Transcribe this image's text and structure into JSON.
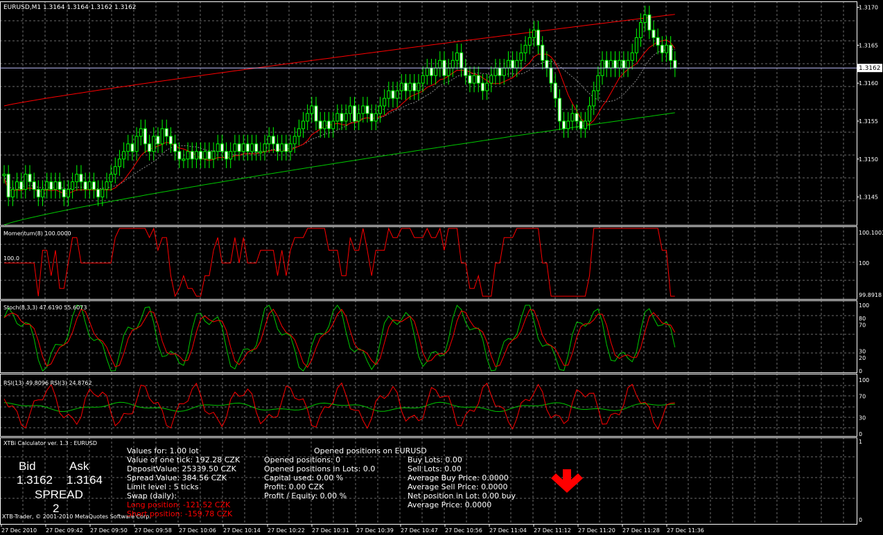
{
  "colors": {
    "bg": "#000000",
    "grid": "#6b6b6b",
    "axis": "#ffffff",
    "upper_band": "#ff0000",
    "lower_band": "#00c800",
    "ma_fast": "#ff0000",
    "candle_up": "#000000",
    "candle_down": "#ffffff",
    "candle_wick": "#00ff00",
    "rsi13": "#00c800",
    "rsi3": "#ff0000",
    "stoch_k": "#00c800",
    "stoch_d": "#ff0000",
    "momentum": "#ff0000",
    "price_line": "#c0c0ff"
  },
  "main": {
    "title": "EURUSD,M1  1.3164 1.3164 1.3162 1.3162",
    "y_ticks": [
      "1.3170",
      "1.3165",
      "1.3160",
      "1.3155",
      "1.3150",
      "1.3145"
    ],
    "current_price": "1.3162"
  },
  "momentum": {
    "title": "Momentum(8) 100.0000",
    "level_label": "100.0",
    "y_ticks": [
      "100.1003",
      "100",
      "99.8918"
    ]
  },
  "stoch": {
    "title": "Stoch(8,3,3) 47.6190 55.6073",
    "y_ticks": [
      "100",
      "80",
      "70",
      "30",
      "20",
      "0"
    ]
  },
  "rsi": {
    "title": "RSI(13) 49.8096  RSI(3) 24.8762",
    "y_ticks": [
      "100",
      "70",
      "30",
      "0"
    ]
  },
  "calc": {
    "title": "XTBi Calculator ver. 1.3 : EURUSD",
    "bid_label": "Bid",
    "ask_label": "Ask",
    "bid": "1.3162",
    "ask": "1.3164",
    "spread_label": "SPREAD",
    "spread": "2",
    "col1": [
      "Values for: 1.00 lot",
      "Value of one tick: 192.28 CZK",
      "DepositValue: 25339.50 CZK",
      "Spread Value: 384.56 CZK",
      "Limit level : 5 ticks",
      "Swap (daily):"
    ],
    "long": "Long position: -121.52 CZK",
    "short": "Short position: -159.78 CZK",
    "opened_title": "Opened positions on EURUSD",
    "col2": [
      "Opened positions: 0",
      "Opened positions in Lots: 0.0",
      "Capital used: 0.00 %",
      "Profit: 0.00 CZK",
      "Profit / Equity: 0.00 %"
    ],
    "col3": [
      "Buy Lots: 0.00",
      "Sell Lots: 0.00",
      "Average Buy Price: 0.0000",
      "Average Sell Price: 0.0000",
      "Net position in Lot: 0.00 buy",
      "Average Price: 0.0000"
    ],
    "copyright": "XTB-Trader, © 2001-2010 MetaQuotes Software Corp.",
    "y_ticks": [
      "1",
      "0"
    ]
  },
  "time_axis": [
    "27 Dec 2010",
    "27 Dec 09:42",
    "27 Dec 09:50",
    "27 Dec 09:58",
    "27 Dec 10:06",
    "27 Dec 10:14",
    "27 Dec 10:22",
    "27 Dec 10:31",
    "27 Dec 10:39",
    "27 Dec 10:47",
    "27 Dec 10:56",
    "27 Dec 11:04",
    "27 Dec 11:12",
    "27 Dec 11:20",
    "27 Dec 11:28",
    "27 Dec 11:36"
  ],
  "chart_data": {
    "type": "line",
    "closes": [
      1.3148,
      1.3145,
      1.3146,
      1.3147,
      1.3146,
      1.3148,
      1.3147,
      1.3146,
      1.3145,
      1.3146,
      1.3147,
      1.3146,
      1.3147,
      1.3146,
      1.3145,
      1.3146,
      1.3147,
      1.3148,
      1.3147,
      1.3146,
      1.3147,
      1.3146,
      1.3145,
      1.3146,
      1.3147,
      1.3148,
      1.3149,
      1.315,
      1.3151,
      1.3152,
      1.3151,
      1.3153,
      1.3154,
      1.3152,
      1.3151,
      1.3153,
      1.3152,
      1.3154,
      1.3153,
      1.3152,
      1.3151,
      1.315,
      1.315,
      1.3151,
      1.315,
      1.3151,
      1.315,
      1.3151,
      1.315,
      1.3151,
      1.3152,
      1.3151,
      1.315,
      1.3151,
      1.3152,
      1.3151,
      1.3152,
      1.3151,
      1.3152,
      1.3151,
      1.3151,
      1.3152,
      1.3153,
      1.3152,
      1.3151,
      1.3152,
      1.3151,
      1.3152,
      1.3153,
      1.3154,
      1.3155,
      1.3156,
      1.3157,
      1.3155,
      1.3154,
      1.3155,
      1.3154,
      1.3155,
      1.3156,
      1.3155,
      1.3156,
      1.3157,
      1.3155,
      1.3156,
      1.3157,
      1.3156,
      1.3155,
      1.3156,
      1.3157,
      1.3158,
      1.3159,
      1.3158,
      1.3159,
      1.316,
      1.3159,
      1.316,
      1.3159,
      1.316,
      1.3161,
      1.3162,
      1.3161,
      1.3162,
      1.3163,
      1.3161,
      1.3162,
      1.3163,
      1.3164,
      1.3162,
      1.3161,
      1.316,
      1.3161,
      1.316,
      1.3159,
      1.316,
      1.3161,
      1.3162,
      1.3161,
      1.3162,
      1.3163,
      1.3162,
      1.3163,
      1.3164,
      1.3165,
      1.3166,
      1.3167,
      1.3165,
      1.3163,
      1.3162,
      1.316,
      1.3158,
      1.3155,
      1.3154,
      1.3155,
      1.3156,
      1.3155,
      1.3154,
      1.3155,
      1.3157,
      1.3159,
      1.3161,
      1.3163,
      1.3162,
      1.3163,
      1.3162,
      1.3163,
      1.3162,
      1.3163,
      1.3164,
      1.3166,
      1.3168,
      1.3169,
      1.3167,
      1.3166,
      1.3165,
      1.3164,
      1.3165,
      1.3163,
      1.3162
    ]
  }
}
